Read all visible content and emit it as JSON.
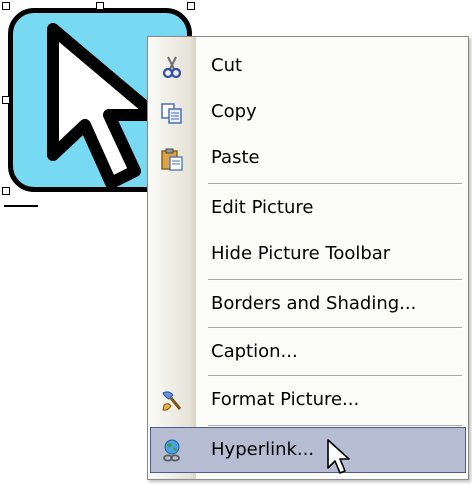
{
  "menu": {
    "cut": "Cut",
    "copy": "Copy",
    "paste": "Paste",
    "edit_picture": "Edit Picture",
    "hide_picture_toolbar": "Hide Picture Toolbar",
    "borders_and_shading": "Borders and Shading...",
    "caption": "Caption...",
    "format_picture": "Format Picture...",
    "hyperlink": "Hyperlink..."
  },
  "icons": {
    "cut": "scissors-icon",
    "copy": "copy-icon",
    "paste": "clipboard-icon",
    "format_picture": "paint-brush-icon",
    "hyperlink": "globe-link-icon",
    "picture": "cursor-arrow-icon",
    "mouse": "mouse-pointer-icon"
  },
  "colors": {
    "picture_fill": "#77d9f2",
    "highlight_bg": "#b6bdd2",
    "highlight_border": "#4b5e8f",
    "gutter": "#e6e3d8"
  },
  "state": {
    "highlighted_item": "hyperlink"
  }
}
